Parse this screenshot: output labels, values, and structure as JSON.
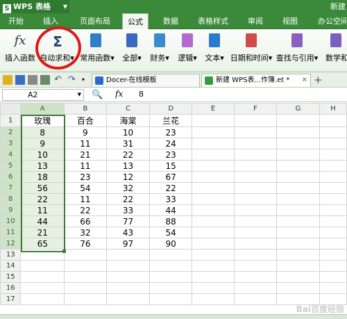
{
  "app": {
    "name": "WPS 表格",
    "logo_letter": "S",
    "new_label": "新建"
  },
  "menu": [
    "开始",
    "插入",
    "页面布局",
    "公式",
    "数据",
    "表格样式",
    "审阅",
    "视图",
    "办公空间"
  ],
  "menu_active": "公式",
  "ribbon": [
    {
      "label": "插入函数",
      "icon": "function-icon"
    },
    {
      "label": "自动求和▾",
      "icon": "sigma-icon"
    },
    {
      "label": "常用函数▾",
      "icon": "book-icon"
    },
    {
      "label": "全部▾",
      "icon": "book-icon"
    },
    {
      "label": "财务▾",
      "icon": "book-icon"
    },
    {
      "label": "逻辑▾",
      "icon": "book-icon"
    },
    {
      "label": "文本▾",
      "icon": "book-icon"
    },
    {
      "label": "日期和时间▾",
      "icon": "book-icon"
    },
    {
      "label": "查找与引用▾",
      "icon": "book-icon"
    },
    {
      "label": "数学和",
      "icon": "book-icon"
    }
  ],
  "ribbon_colors": [
    "#3a6ac0",
    "#3a6ac0",
    "#3a6ac0",
    "#9a5fc0",
    "#3a8ad0",
    "#2a7ad0",
    "#d03a3a",
    "#7a5fc0",
    "#7a5fc0"
  ],
  "tabs": [
    {
      "label": "Docer-在线模板"
    },
    {
      "label": "新建 WPS表...作簿.et *"
    }
  ],
  "formula_bar": {
    "cell_ref": "A2",
    "fx": "fx",
    "value": "8"
  },
  "columns": [
    "A",
    "B",
    "C",
    "D",
    "E",
    "F",
    "G",
    "H"
  ],
  "rows": [
    [
      "玫瑰",
      "百合",
      "海棠",
      "兰花"
    ],
    [
      "8",
      "9",
      "10",
      "23"
    ],
    [
      "9",
      "11",
      "31",
      "24"
    ],
    [
      "10",
      "21",
      "22",
      "23"
    ],
    [
      "13",
      "11",
      "13",
      "15"
    ],
    [
      "18",
      "23",
      "12",
      "67"
    ],
    [
      "56",
      "54",
      "32",
      "22"
    ],
    [
      "22",
      "11",
      "22",
      "33"
    ],
    [
      "11",
      "22",
      "33",
      "44"
    ],
    [
      "44",
      "66",
      "77",
      "88"
    ],
    [
      "21",
      "32",
      "43",
      "54"
    ],
    [
      "65",
      "76",
      "97",
      "90"
    ],
    [
      "",
      "",
      "",
      ""
    ],
    [
      "",
      "",
      "",
      ""
    ],
    [
      "",
      "",
      "",
      ""
    ],
    [
      "",
      "",
      "",
      ""
    ],
    [
      "",
      "",
      "",
      ""
    ]
  ],
  "watermark": "Bai百度经验",
  "accent": "#3a8a3a"
}
